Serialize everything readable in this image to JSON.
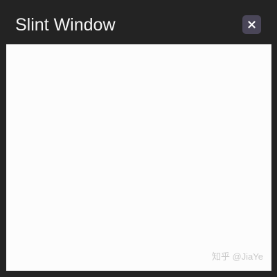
{
  "window": {
    "title": "Slint Window",
    "close_icon": "close-icon"
  },
  "watermark": {
    "text": "知乎 @JiaYe"
  },
  "colors": {
    "frame": "#232323",
    "content_bg": "#fcfcfc",
    "close_button_bg": "#4a4658",
    "title_text": "#f4f4f4"
  }
}
